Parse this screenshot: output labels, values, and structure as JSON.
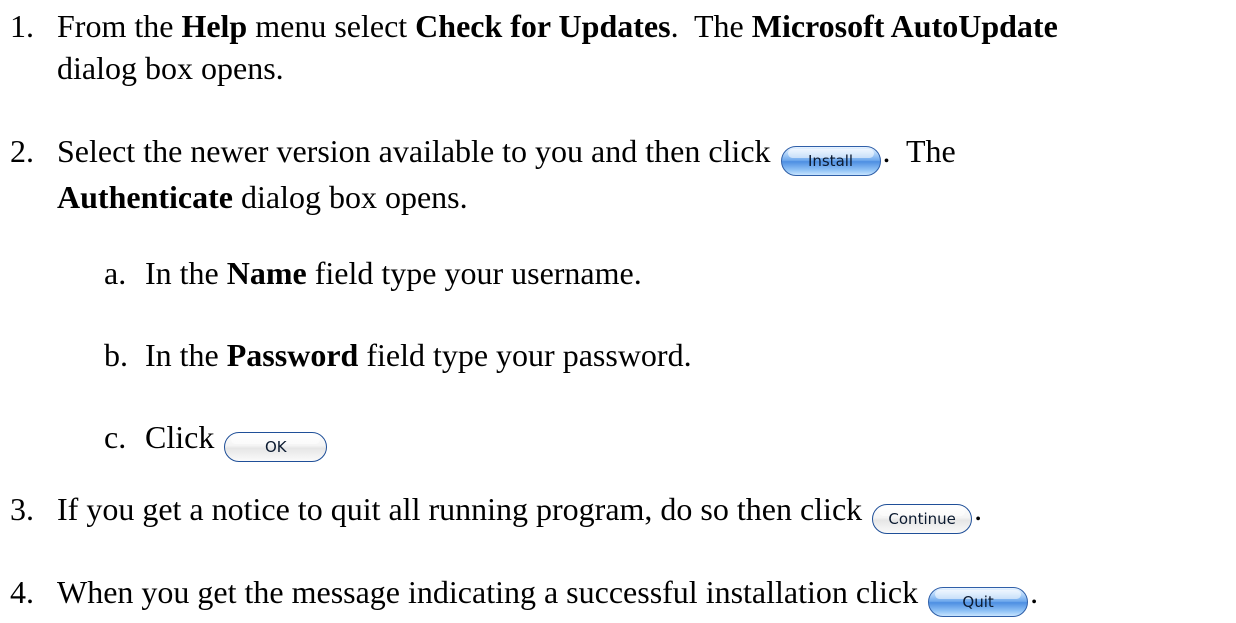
{
  "steps": [
    {
      "num": "1.",
      "line1": {
        "t1": "From the ",
        "b1": "Help",
        "t2": " menu select ",
        "b2": "Check for Updates",
        "t3": ".  The ",
        "b3": "Microsoft AutoUpdate"
      },
      "line2": "dialog box opens."
    },
    {
      "num": "2.",
      "line1": {
        "t1": "Select the newer version available to you and then click ",
        "button": "Install",
        "t2": ".  The"
      },
      "line2": {
        "b1": "Authenticate",
        "t1": " dialog box opens."
      },
      "substeps": [
        {
          "letter": "a.",
          "t1": "In the ",
          "b1": "Name",
          "t2": " field type your username."
        },
        {
          "letter": "b.",
          "t1": "In the ",
          "b1": "Password",
          "t2": " field type your password."
        },
        {
          "letter": "c.",
          "t1": "Click ",
          "button": "OK"
        }
      ]
    },
    {
      "num": "3.",
      "t1": "If you get a notice to quit all running program, do so then click ",
      "button": "Continue",
      "t2": "."
    },
    {
      "num": "4.",
      "t1": "When you get the message indicating a successful installation click ",
      "button": "Quit",
      "t2": "."
    }
  ]
}
